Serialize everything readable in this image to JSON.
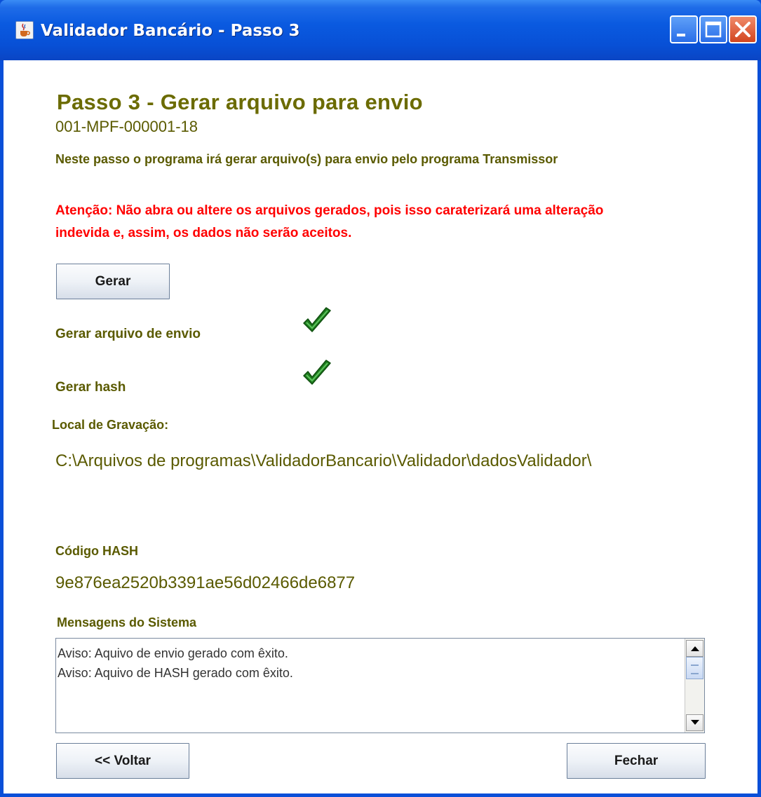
{
  "window": {
    "title": "Validador Bancário - Passo 3",
    "icon": "java-cup-icon",
    "controls": [
      "minimize-icon",
      "maximize-icon",
      "close-icon"
    ]
  },
  "main": {
    "heading": "Passo 3 - Gerar arquivo para envio",
    "code": "001-MPF-000001-18",
    "intro": "Neste passo o programa irá gerar arquivo(s) para envio pelo programa Transmissor",
    "warning": "Atenção: Não abra ou altere os arquivos gerados, pois isso caraterizará uma alteração indevida e, assim, os dados não serão aceitos.",
    "generate_button": "Gerar",
    "steps": [
      {
        "label": "Gerar arquivo de envio",
        "status_icon": "check-icon"
      },
      {
        "label": "Gerar hash",
        "status_icon": "check-icon"
      }
    ],
    "save_location_label": "Local de Gravação:",
    "save_location_path": "C:\\Arquivos de programas\\ValidadorBancario\\Validador\\dadosValidador\\",
    "hash_label": "Código HASH",
    "hash_value": "9e876ea2520b3391ae56d02466de6877",
    "messages_label": "Mensagens do Sistema",
    "messages": [
      "Aviso: Aquivo de envio gerado com êxito.",
      "Aviso: Aquivo de HASH gerado com êxito."
    ],
    "back_button": "<< Voltar",
    "close_button": "Fechar"
  },
  "colors": {
    "titlebar": "#0a5ae0",
    "text_olive": "#5a5a00",
    "warning_red": "#ff0000",
    "check_green": "#1e7a1e"
  }
}
